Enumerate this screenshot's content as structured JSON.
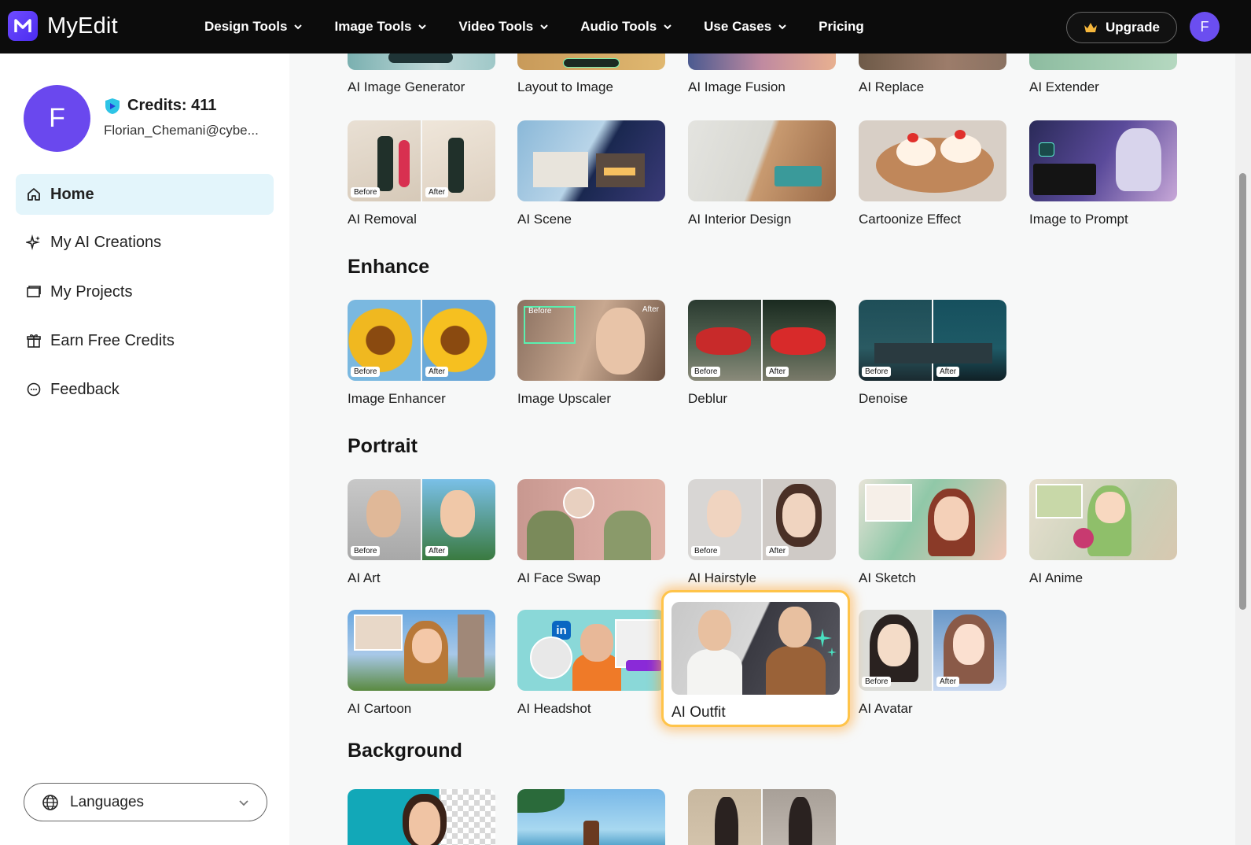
{
  "brand": {
    "name": "MyEdit",
    "accent": "#6b4ef0"
  },
  "nav": {
    "items": [
      "Design Tools",
      "Image Tools",
      "Video Tools",
      "Audio Tools",
      "Use Cases"
    ],
    "pricing": "Pricing",
    "upgrade": "Upgrade",
    "avatar_initial": "F"
  },
  "sidebar": {
    "avatar_initial": "F",
    "credits": "Credits: 411",
    "email": "Florian_Chemani@cybe...",
    "items": [
      {
        "label": "Home",
        "icon": "home-icon"
      },
      {
        "label": "My AI Creations",
        "icon": "sparkle-icon"
      },
      {
        "label": "My Projects",
        "icon": "folder-icon"
      },
      {
        "label": "Earn Free Credits",
        "icon": "gift-icon"
      },
      {
        "label": "Feedback",
        "icon": "chat-icon"
      }
    ],
    "languages": "Languages"
  },
  "tools": {
    "partial_row": [
      "AI Image Generator",
      "Layout to Image",
      "AI Image Fusion",
      "AI Replace",
      "AI Extender"
    ],
    "generate_row": [
      "AI Removal",
      "AI Scene",
      "AI Interior Design",
      "Cartoonize Effect",
      "Image to Prompt"
    ],
    "enhance": {
      "title": "Enhance",
      "items": [
        "Image Enhancer",
        "Image Upscaler",
        "Deblur",
        "Denoise"
      ]
    },
    "portrait": {
      "title": "Portrait",
      "row1": [
        "AI Art",
        "AI Face Swap",
        "AI Hairstyle",
        "AI Sketch",
        "AI Anime"
      ],
      "row2": [
        "AI Cartoon",
        "AI Headshot",
        "AI Outfit",
        "AI Avatar"
      ]
    },
    "background": {
      "title": "Background"
    },
    "tags": {
      "before": "Before",
      "after": "After"
    }
  }
}
